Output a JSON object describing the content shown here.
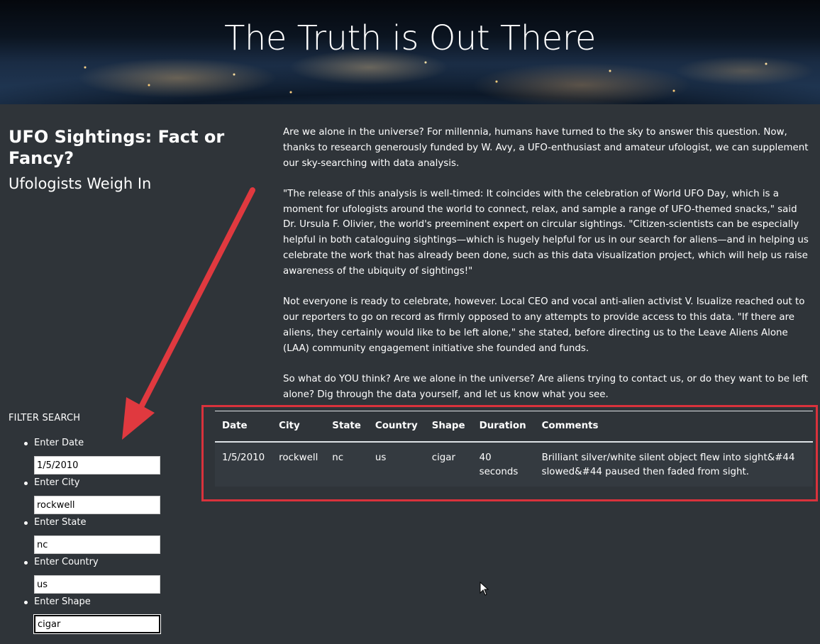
{
  "hero": {
    "title": "The Truth is Out There"
  },
  "headline": {
    "title": "UFO Sightings: Fact or Fancy?",
    "subtitle": "Ufologists Weigh In"
  },
  "article": {
    "paragraphs": [
      "Are we alone in the universe? For millennia, humans have turned to the sky to answer this question. Now, thanks to research generously funded by W. Avy, a UFO-enthusiast and amateur ufologist, we can supplement our sky-searching with data analysis.",
      "\"The release of this analysis is well-timed: It coincides with the celebration of World UFO Day, which is a moment for ufologists around the world to connect, relax, and sample a range of UFO-themed snacks,\" said Dr. Ursula F. Olivier, the world's preeminent expert on circular sightings. \"Citizen-scientists can be especially helpful in both cataloguing sightings—which is hugely helpful for us in our search for aliens—and in helping us celebrate the work that has already been done, such as this data visualization project, which will help us raise awareness of the ubiquity of sightings!\"",
      "Not everyone is ready to celebrate, however. Local CEO and vocal anti-alien activist V. Isualize reached out to our reporters to go on record as firmly opposed to any attempts to provide access to this data. \"If there are aliens, they certainly would like to be left alone,\" she stated, before directing us to the Leave Aliens Alone (LAA) community engagement initiative she founded and funds.",
      "So what do YOU think? Are we alone in the universe? Are aliens trying to contact us, or do they want to be left alone? Dig through the data yourself, and let us know what you see."
    ]
  },
  "filters": {
    "title": "FILTER SEARCH",
    "items": [
      {
        "label": "Enter Date",
        "value": "1/5/2010"
      },
      {
        "label": "Enter City",
        "value": "rockwell"
      },
      {
        "label": "Enter State",
        "value": "nc"
      },
      {
        "label": "Enter Country",
        "value": "us"
      },
      {
        "label": "Enter Shape",
        "value": "cigar"
      }
    ]
  },
  "table": {
    "headers": [
      "Date",
      "City",
      "State",
      "Country",
      "Shape",
      "Duration",
      "Comments"
    ],
    "rows": [
      [
        "1/5/2010",
        "rockwell",
        "nc",
        "us",
        "cigar",
        "40 seconds",
        "Brilliant silver/white silent object flew into sight&#44 slowed&#44 paused then faded from sight."
      ]
    ]
  },
  "colors": {
    "background": "#2f3439",
    "highlight_border": "#d9323c",
    "arrow": "#e0393f"
  }
}
